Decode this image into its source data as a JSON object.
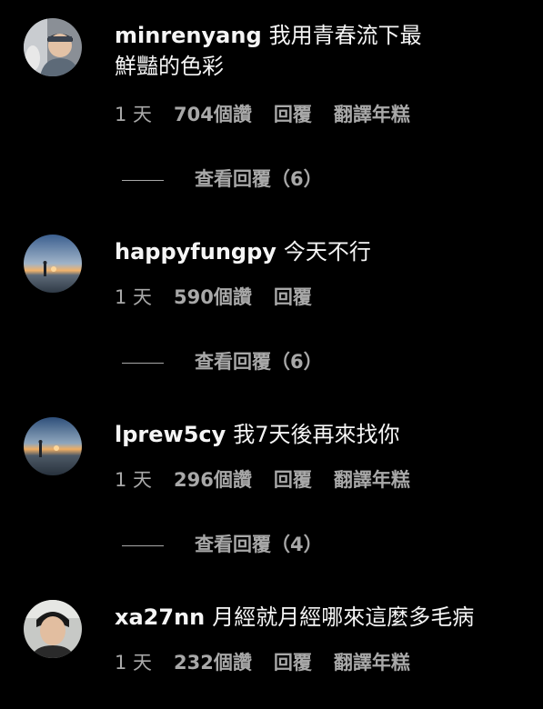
{
  "comments": [
    {
      "username": "minrenyang",
      "text": "我用青春流下最鮮豔的色彩",
      "time": "1 天",
      "likes": "704個讚",
      "reply": "回覆",
      "translate": "翻譯年糕",
      "view_replies": "查看回覆（6）"
    },
    {
      "username": "happyfungpy",
      "text": "今天不行",
      "time": "1 天",
      "likes": "590個讚",
      "reply": "回覆",
      "view_replies": "查看回覆（6）"
    },
    {
      "username": "lprew5cy",
      "text": "我7天後再來找你",
      "time": "1 天",
      "likes": "296個讚",
      "reply": "回覆",
      "translate": "翻譯年糕",
      "view_replies": "查看回覆（4）"
    },
    {
      "username": "xa27nn",
      "text": "月經就月經哪來這麼多毛病",
      "time": "1 天",
      "likes": "232個讚",
      "reply": "回覆",
      "translate": "翻譯年糕"
    }
  ],
  "colors": {
    "background": "#000000",
    "primary_text": "#f5f5f5",
    "secondary_text": "#a8a8a8"
  }
}
